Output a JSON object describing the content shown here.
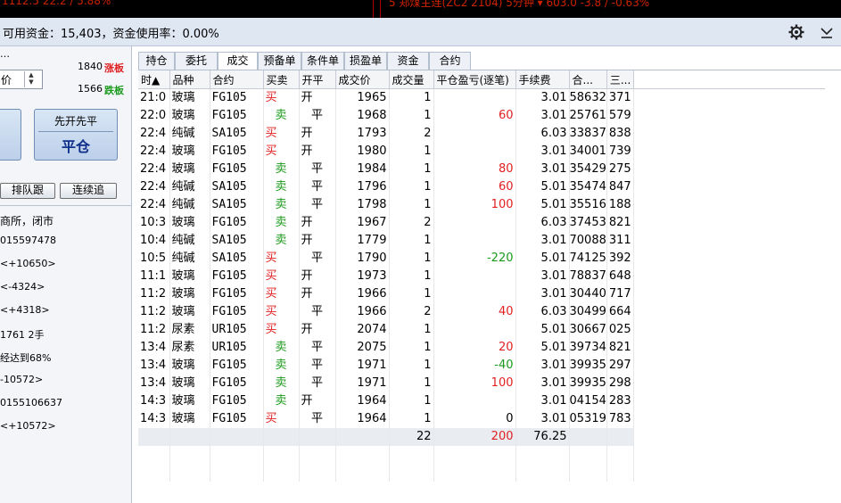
{
  "top_strip": {
    "left_text": "1112.5  22.2 / 5.88%",
    "right_text": "5  郑煤主连(ZC2 2104)  5分钟 ▾   603.0   -3.8 / -0.63%"
  },
  "funds": {
    "text": "可用资金：15,403，资金使用率：0.00%"
  },
  "left_panel": {
    "top_dots": "…",
    "price_label": "价",
    "limit_up_value": "1840",
    "limit_up_label": "涨板",
    "limit_down_value": "1566",
    "limit_down_label": "跌板",
    "big_button_line1": "先开先平",
    "big_button_line2": "平仓",
    "queue_follow": "排队跟",
    "chase": "连续追",
    "status": "商所，闭市",
    "messages": [
      "015597478",
      "<+10650>",
      "<-4324>",
      "<+4318>",
      "1761  2手",
      "经达到68%",
      "-10572>",
      "0155106637",
      "<+10572>"
    ]
  },
  "tabs": [
    "持仓",
    "委托",
    "成交",
    "预备单",
    "条件单",
    "损盈单",
    "资金",
    "合约"
  ],
  "active_tab": 2,
  "table": {
    "columns": [
      "时▲",
      "品种",
      "合约",
      "买卖",
      "开平",
      "成交价",
      "成交量",
      "平仓盈亏(逐笔)",
      "手续费",
      "合...",
      "三..."
    ],
    "rows": [
      [
        "21:0",
        "玻璃",
        "FG105",
        "买",
        "开",
        "1965",
        "1",
        "",
        "3.01",
        "58632",
        "371"
      ],
      [
        "22:0",
        "玻璃",
        "FG105",
        "卖",
        "平",
        "1968",
        "1",
        "60",
        "3.01",
        "25761",
        "579"
      ],
      [
        "22:4",
        "纯碱",
        "SA105",
        "买",
        "开",
        "1793",
        "2",
        "",
        "6.03",
        "33837",
        "838"
      ],
      [
        "22:4",
        "玻璃",
        "FG105",
        "买",
        "开",
        "1980",
        "1",
        "",
        "3.01",
        "34001",
        "739"
      ],
      [
        "22:4",
        "玻璃",
        "FG105",
        "卖",
        "平",
        "1984",
        "1",
        "80",
        "3.01",
        "35429",
        "275"
      ],
      [
        "22:4",
        "纯碱",
        "SA105",
        "卖",
        "平",
        "1796",
        "1",
        "60",
        "5.01",
        "35474",
        "847"
      ],
      [
        "22:4",
        "纯碱",
        "SA105",
        "卖",
        "平",
        "1798",
        "1",
        "100",
        "5.01",
        "35516",
        "188"
      ],
      [
        "10:3",
        "玻璃",
        "FG105",
        "卖",
        "开",
        "1967",
        "2",
        "",
        "6.03",
        "37453",
        "821"
      ],
      [
        "10:4",
        "纯碱",
        "SA105",
        "卖",
        "开",
        "1779",
        "1",
        "",
        "3.01",
        "70088",
        "311"
      ],
      [
        "10:5",
        "纯碱",
        "SA105",
        "买",
        "平",
        "1790",
        "1",
        "-220",
        "5.01",
        "74125",
        "392"
      ],
      [
        "11:1",
        "玻璃",
        "FG105",
        "买",
        "开",
        "1973",
        "1",
        "",
        "3.01",
        "78837",
        "648"
      ],
      [
        "11:2",
        "玻璃",
        "FG105",
        "买",
        "开",
        "1966",
        "1",
        "",
        "3.01",
        "30440",
        "717"
      ],
      [
        "11:2",
        "玻璃",
        "FG105",
        "买",
        "平",
        "1966",
        "2",
        "40",
        "6.03",
        "30499",
        "664"
      ],
      [
        "11:2",
        "尿素",
        "UR105",
        "买",
        "开",
        "2074",
        "1",
        "",
        "5.01",
        "30667",
        "025"
      ],
      [
        "13:4",
        "尿素",
        "UR105",
        "卖",
        "平",
        "2075",
        "1",
        "20",
        "5.01",
        "39734",
        "821"
      ],
      [
        "13:4",
        "玻璃",
        "FG105",
        "卖",
        "平",
        "1971",
        "1",
        "-40",
        "3.01",
        "39935",
        "297"
      ],
      [
        "13:4",
        "玻璃",
        "FG105",
        "卖",
        "平",
        "1971",
        "1",
        "100",
        "3.01",
        "39935",
        "298"
      ],
      [
        "14:3",
        "玻璃",
        "FG105",
        "卖",
        "开",
        "1964",
        "1",
        "",
        "3.01",
        "04154",
        "283"
      ],
      [
        "14:3",
        "玻璃",
        "FG105",
        "买",
        "平",
        "1964",
        "1",
        "0",
        "3.01",
        "05319",
        "783"
      ]
    ],
    "summary": {
      "volume": "22",
      "profit": "200",
      "fee": "76.25"
    }
  },
  "colors": {
    "buy": "#e02020",
    "sell": "#1c9a1c",
    "header_bg": "#dfe7f3"
  }
}
